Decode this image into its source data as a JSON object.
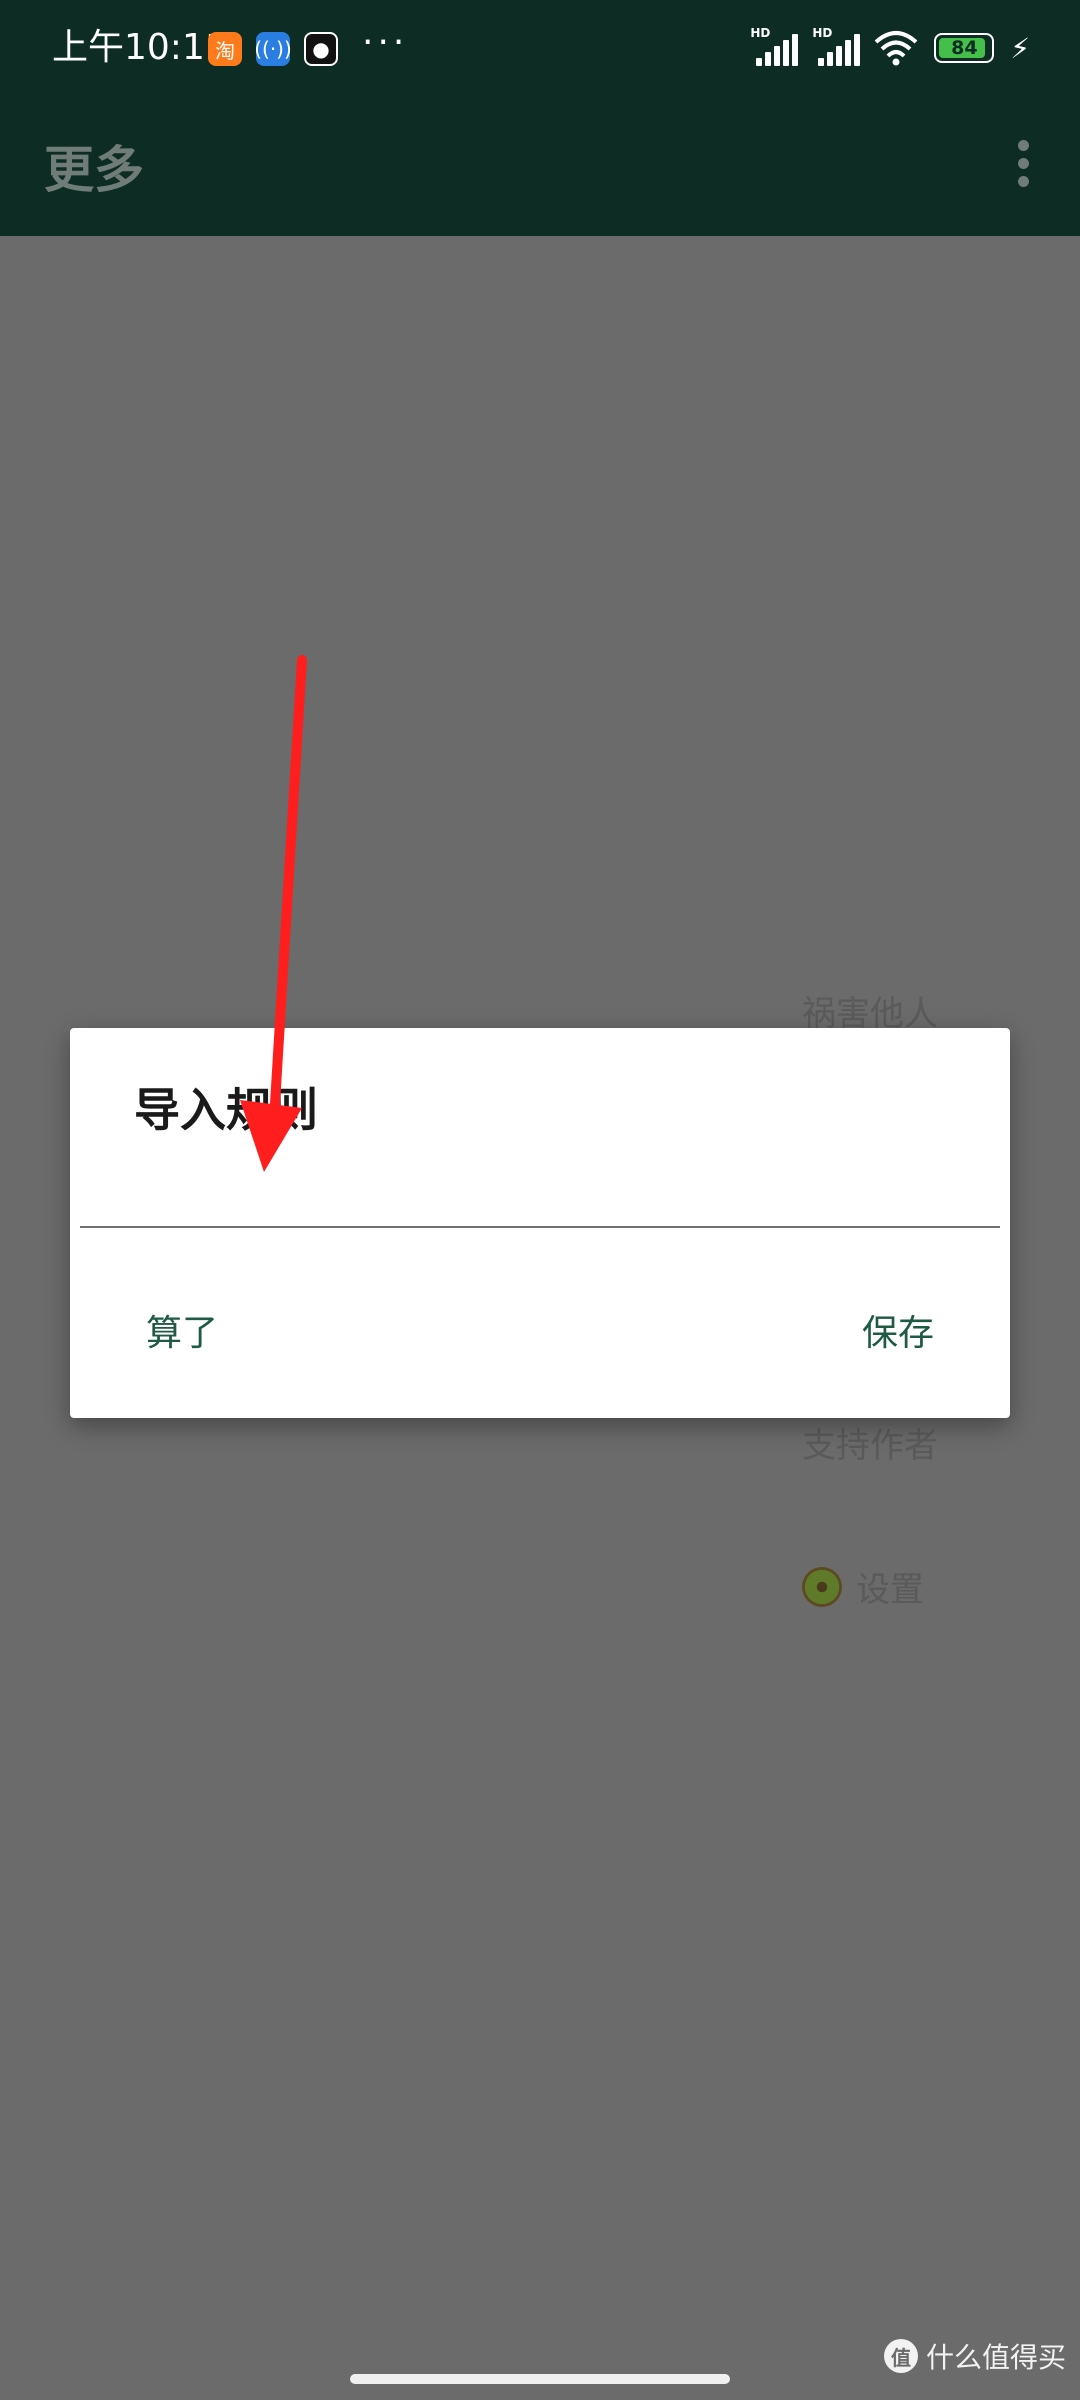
{
  "status_bar": {
    "time": "上午10:11",
    "app_icons": [
      "taobao-icon",
      "radio-icon",
      "qq-icon"
    ],
    "more": "···",
    "signal_label_1": "HD",
    "signal_label_2": "HD",
    "battery_level": "84"
  },
  "app_bar": {
    "title": "更多"
  },
  "background_menu": {
    "item_1": "祸害他人",
    "item_2": "支持作者",
    "item_3": "设置"
  },
  "dialog": {
    "title": "导入规则",
    "input_value": "",
    "cancel_label": "算了",
    "save_label": "保存"
  },
  "watermark": {
    "text": "什么值得买",
    "logo": "值"
  },
  "colors": {
    "primary_dark": "#0d2c24",
    "scrim": "#6b6b6b",
    "button_text": "#1f5a43",
    "annotation_arrow": "#ff1e1e"
  }
}
